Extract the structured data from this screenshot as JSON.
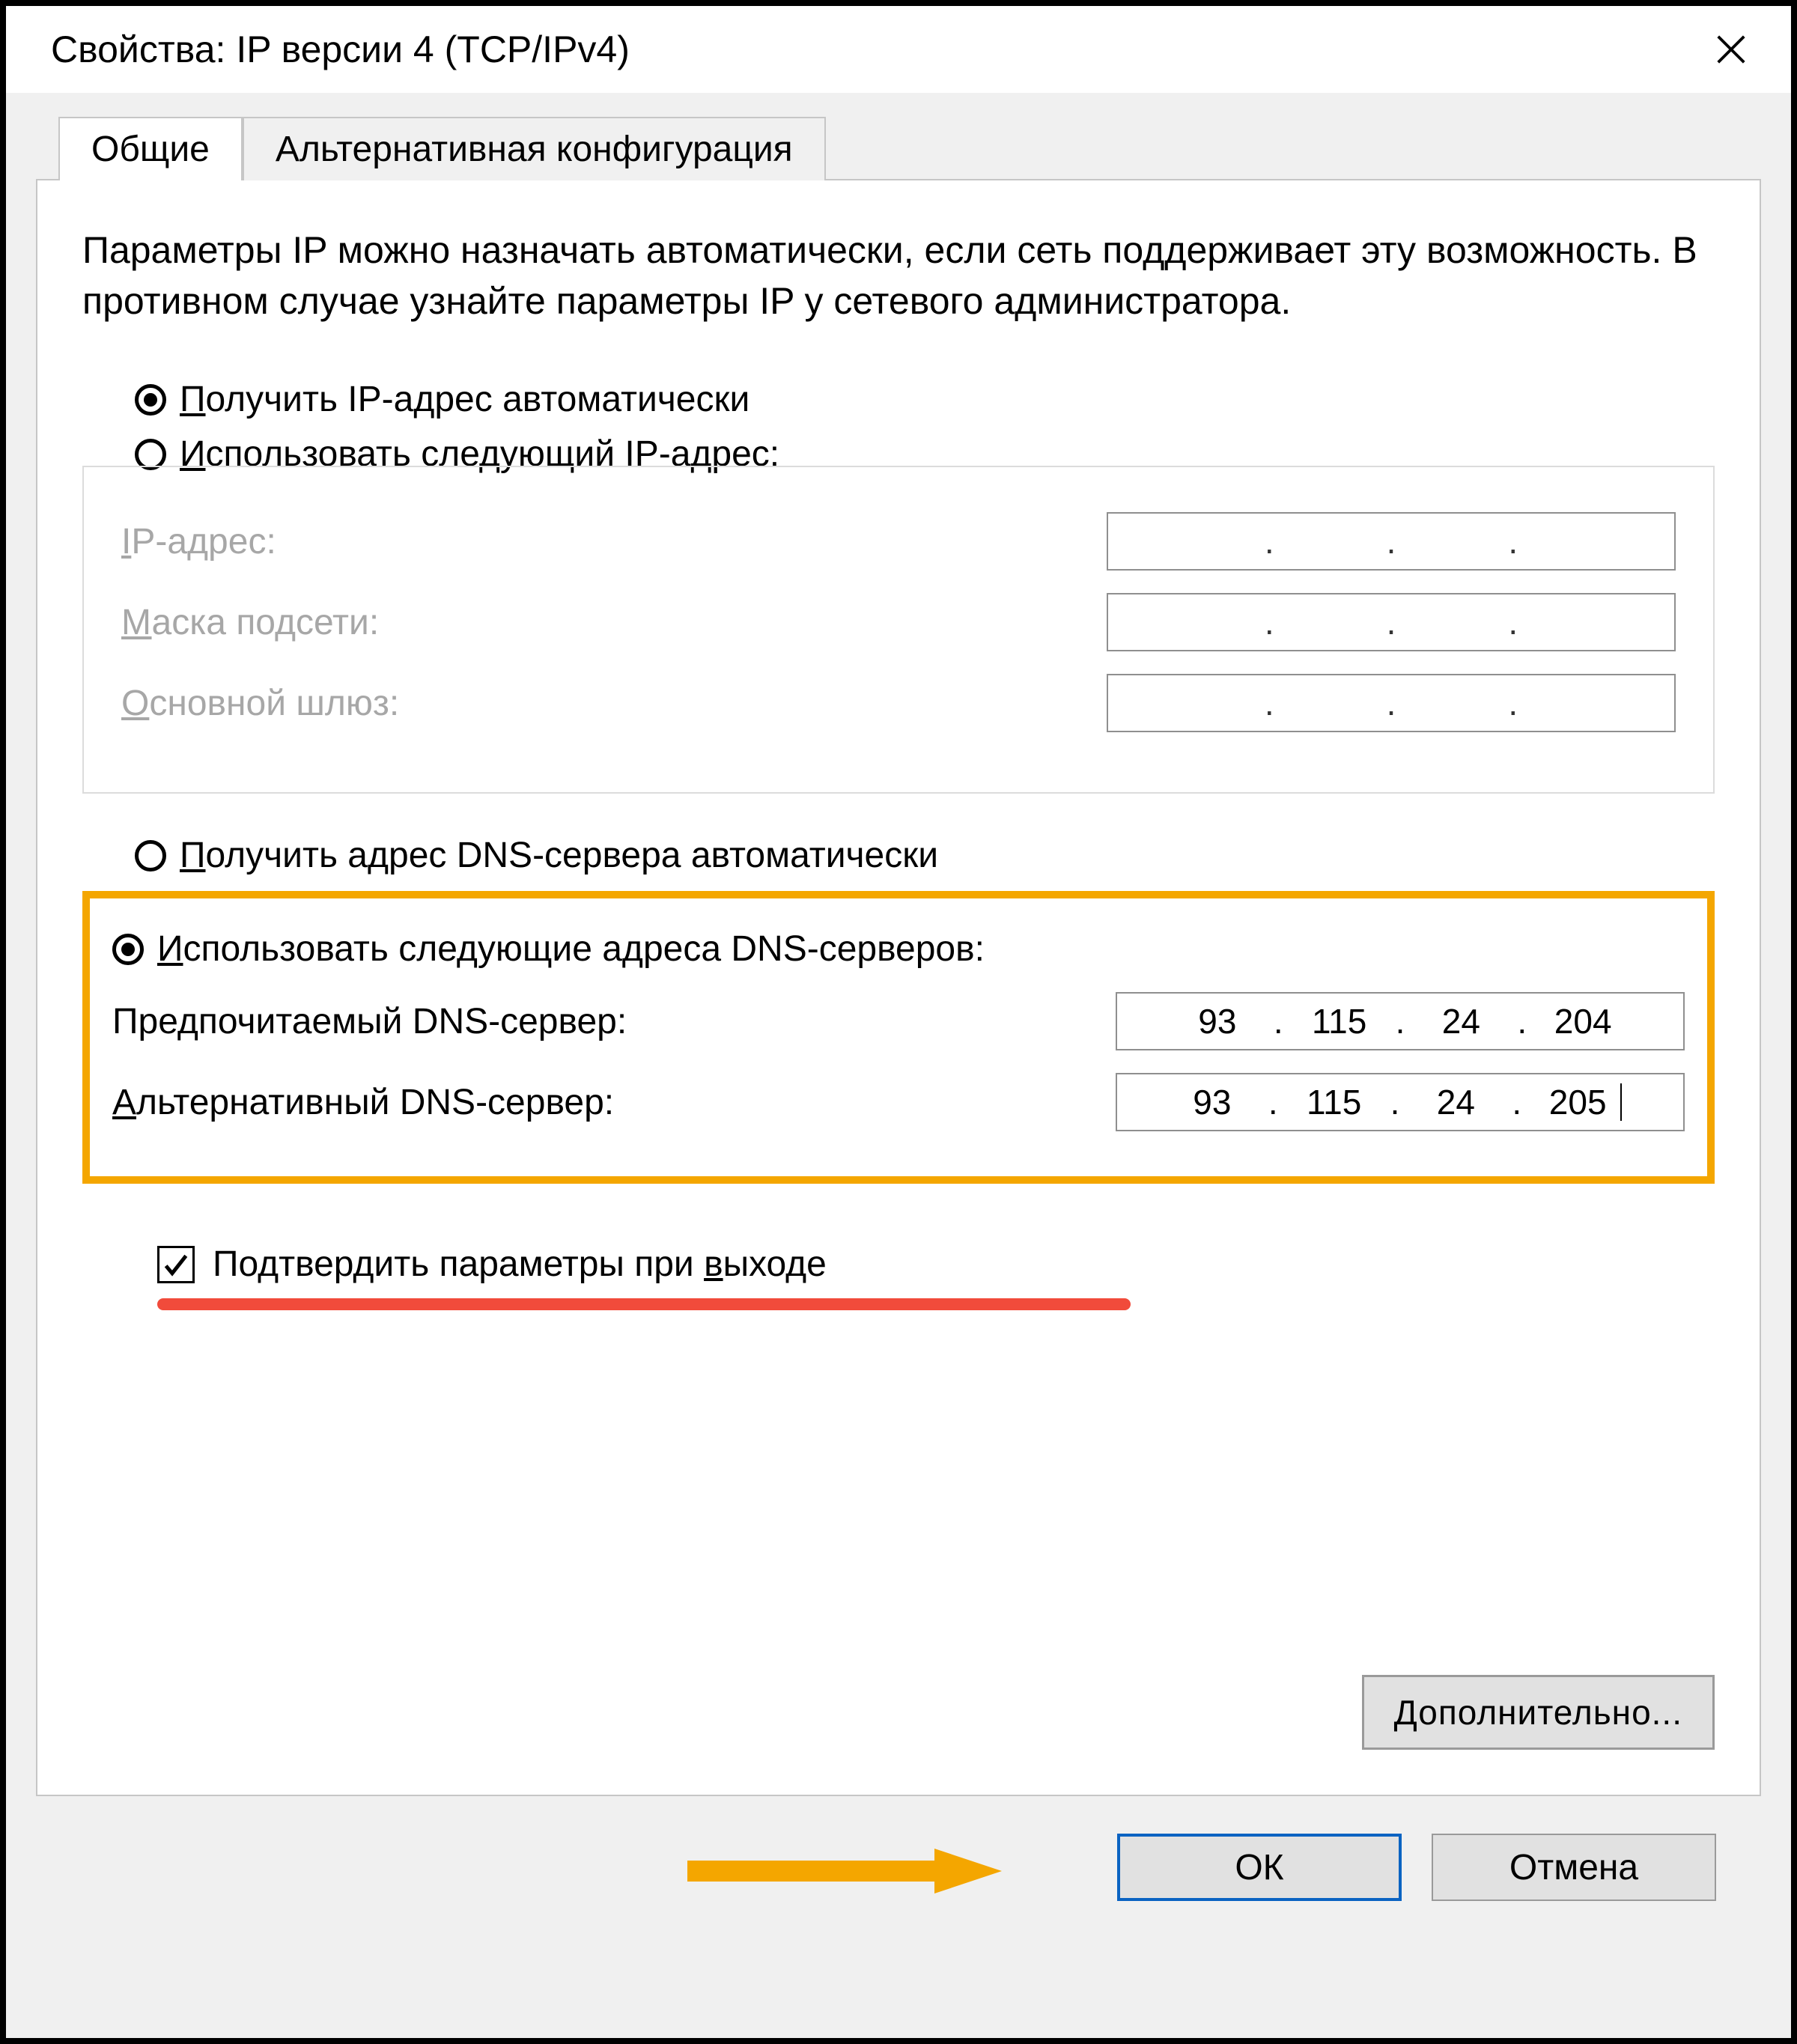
{
  "window": {
    "title": "Свойства: IP версии 4 (TCP/IPv4)"
  },
  "tabs": {
    "general": "Общие",
    "alt": "Альтернативная конфигурация"
  },
  "intro": "Параметры IP можно назначать автоматически, если сеть поддерживает эту возможность. В противном случае узнайте параметры IP у сетевого администратора.",
  "ip_auto_label_pre": "П",
  "ip_auto_label_post": "олучить IP-адрес автоматически",
  "ip_manual_label_pre": "И",
  "ip_manual_label_post": "спользовать следующий IP-адрес:",
  "ip_fields": {
    "addr_label_pre": "I",
    "addr_label_post": "P-адрес:",
    "mask_label_pre": "М",
    "mask_label_post": "аска подсети:",
    "gw_label_pre": "О",
    "gw_label_post": "сновной шлюз:"
  },
  "dns_auto_label_pre": "П",
  "dns_auto_label_post": "олучить адрес DNS-сервера автоматически",
  "dns_manual_label_pre": "И",
  "dns_manual_label_post": "спользовать следующие адреса DNS-серверов:",
  "dns_fields": {
    "pref_label": "Предпочитаемый DNS-сервер:",
    "pref_value": [
      "93",
      "115",
      "24",
      "204"
    ],
    "alt_label_pre": "А",
    "alt_label_post": "льтернативный DNS-сервер:",
    "alt_value": [
      "93",
      "115",
      "24",
      "205"
    ]
  },
  "validate_checkbox_pre": "Подтвердить параметры при ",
  "validate_checkbox_u": "в",
  "validate_checkbox_post": "ыходе",
  "advanced_btn_pre": "Д",
  "advanced_btn_post": "ополнительно...",
  "footer": {
    "ok": "ОК",
    "cancel": "Отмена"
  }
}
